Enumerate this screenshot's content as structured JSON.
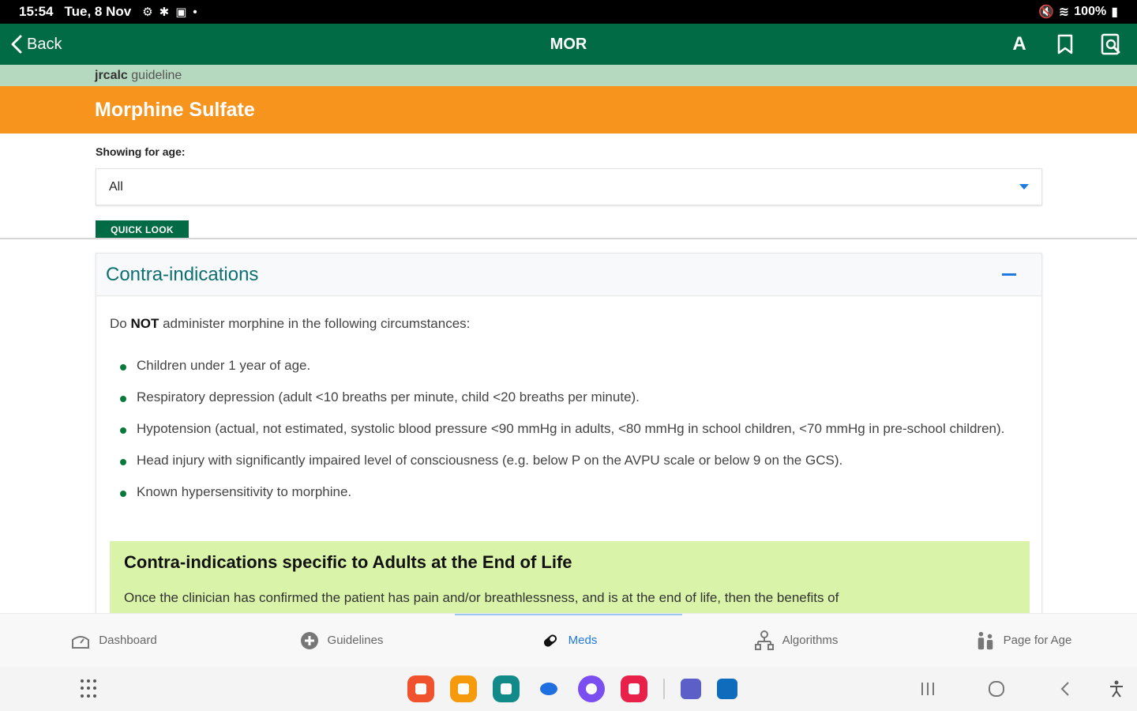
{
  "status_bar": {
    "time": "15:54",
    "date": "Tue, 8 Nov",
    "battery": "100%"
  },
  "app_bar": {
    "back_label": "Back",
    "title": "MOR",
    "font_size_icon": "A"
  },
  "source": {
    "brand": "jrcalc",
    "label": "guideline"
  },
  "drug": {
    "name": "Morphine Sulfate"
  },
  "age_filter": {
    "label": "Showing for age:",
    "selected": "All"
  },
  "quick_look": {
    "label": "QUICK LOOK"
  },
  "contra": {
    "title": "Contra-indications",
    "intro_prefix": "Do",
    "intro_bold": "NOT",
    "intro_suffix": "administer morphine in the following circumstances:",
    "items": [
      "Children under 1 year of age.",
      "Respiratory depression (adult <10 breaths per minute, child <20 breaths per minute).",
      "Hypotension (actual, not estimated, systolic blood pressure <90 mmHg in adults, <80 mmHg in school children, <70 mmHg in pre-school children).",
      "Head injury with significantly impaired level of consciousness (e.g. below P on the AVPU scale or below 9 on the GCS).",
      "Known hypersensitivity to morphine."
    ],
    "eol_title": "Contra-indications specific to Adults at the End of Life",
    "eol_text": "Once the clinician has confirmed the patient has pain and/or breathlessness, and is at the end of life, then the benefits of"
  },
  "bottom_nav": {
    "items": [
      {
        "label": "Dashboard",
        "icon": "dashboard-icon"
      },
      {
        "label": "Guidelines",
        "icon": "guidelines-icon"
      },
      {
        "label": "Meds",
        "icon": "pill-icon"
      },
      {
        "label": "Algorithms",
        "icon": "algorithms-icon"
      },
      {
        "label": "Page for Age",
        "icon": "people-icon"
      }
    ],
    "active": "Meds"
  },
  "dock": {
    "apps": [
      {
        "name": "app-red-icon",
        "color": "#f0522e"
      },
      {
        "name": "app-orange-icon",
        "color": "#f59a0c"
      },
      {
        "name": "app-teal-icon",
        "color": "#138a8a"
      },
      {
        "name": "app-chat-icon",
        "color": "#1f6fe0"
      },
      {
        "name": "app-purple-icon",
        "color": "#7b4ef0"
      },
      {
        "name": "app-pink-icon",
        "color": "#e8214a"
      },
      {
        "name": "teams-icon",
        "color": "#5b5fc7"
      },
      {
        "name": "outlook-icon",
        "color": "#0f6cbd"
      }
    ]
  },
  "colors": {
    "green": "#006b45",
    "orange": "#f7941e",
    "mint": "#b5d9bf",
    "lime": "#d9f4a8",
    "accent_blue": "#1e7ae0"
  }
}
